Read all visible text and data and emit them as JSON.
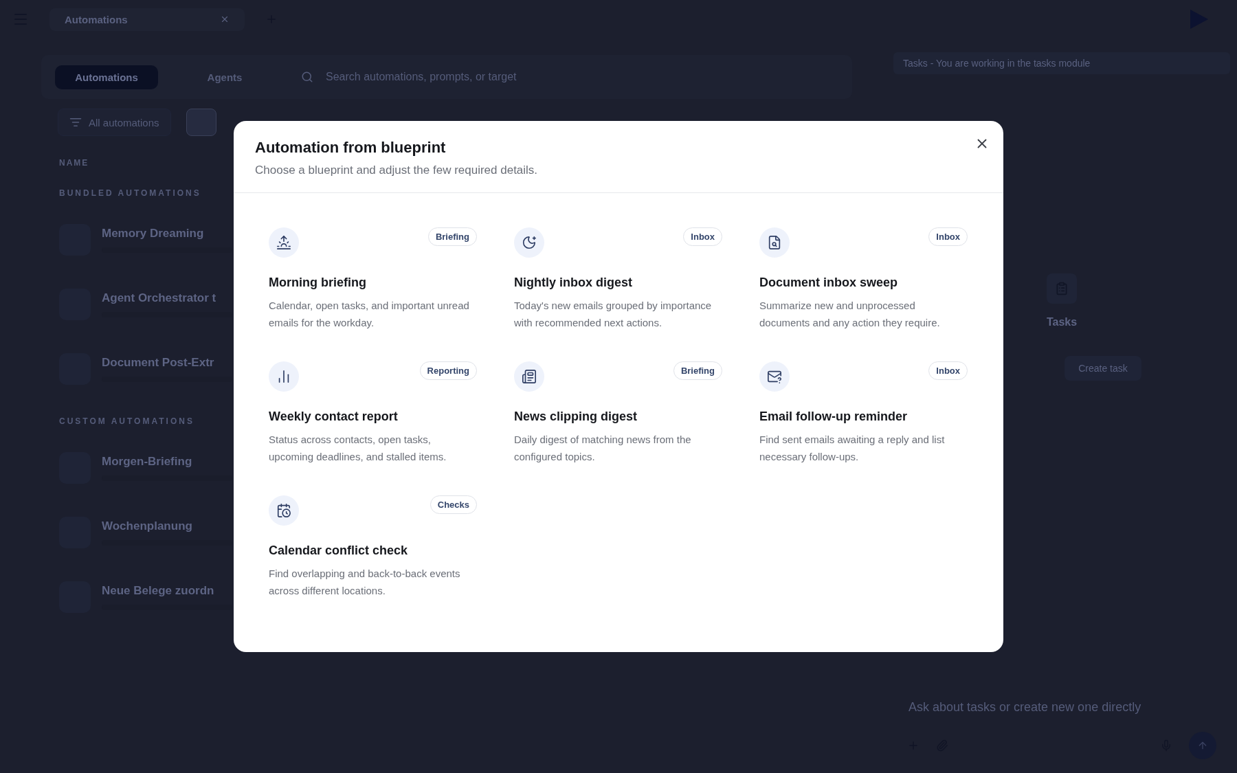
{
  "app": {
    "tab_title": "Automations"
  },
  "toolbar": {
    "tabs": [
      {
        "label": "Automations",
        "selected": true
      },
      {
        "label": "Agents",
        "selected": false
      }
    ],
    "search": {
      "placeholder": "Search automations, prompts, or target"
    },
    "filter": "All automations"
  },
  "list": {
    "column_header": "NAME",
    "sections": [
      {
        "title": "BUNDLED AUTOMATIONS",
        "items": [
          "Memory Dreaming",
          "Agent Orchestrator t",
          "Document Post-Extr"
        ]
      },
      {
        "title": "CUSTOM AUTOMATIONS",
        "items": [
          "Morgen-Briefing",
          "Wochenplanung",
          "Neue Belege zuordn"
        ]
      }
    ]
  },
  "tasks_panel": {
    "banner": "Tasks - You are working in the tasks module",
    "title": "Tasks",
    "button": "Create task",
    "composer": {
      "placeholder": "Ask about tasks or create new one directly"
    }
  },
  "modal": {
    "title": "Automation from blueprint",
    "subtitle": "Choose a blueprint and adjust the few required details.",
    "blueprints": [
      {
        "title": "Morning briefing",
        "description": "Calendar, open tasks, and important unread emails for the workday.",
        "tag": "Briefing"
      },
      {
        "title": "Nightly inbox digest",
        "description": "Today's new emails grouped by importance with recommended next actions.",
        "tag": "Inbox"
      },
      {
        "title": "Document inbox sweep",
        "description": "Summarize new and unprocessed documents and any action they require.",
        "tag": "Inbox"
      },
      {
        "title": "Weekly contact report",
        "description": "Status across contacts, open tasks, upcoming deadlines, and stalled items.",
        "tag": "Reporting"
      },
      {
        "title": "News clipping digest",
        "description": "Daily digest of matching news from the configured topics.",
        "tag": "Briefing"
      },
      {
        "title": "Email follow-up reminder",
        "description": "Find sent emails awaiting a reply and list necessary follow-ups.",
        "tag": "Inbox"
      },
      {
        "title": "Calendar conflict check",
        "description": "Find overlapping and back-to-back events across different locations.",
        "tag": "Checks"
      }
    ]
  }
}
